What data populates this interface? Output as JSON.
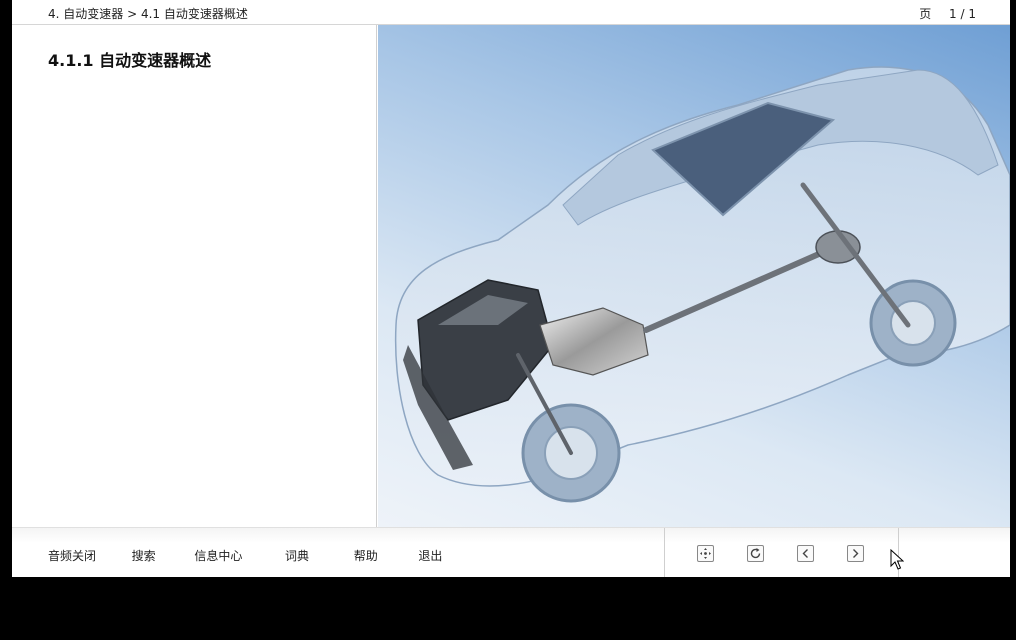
{
  "header": {
    "breadcrumb": "4. 自动变速器 > 4.1 自动变速器概述",
    "page_label": "页",
    "page_value": "1 / 1"
  },
  "content": {
    "section_title": "4.1.1 自动变速器概述"
  },
  "footer": {
    "links": [
      "音频关闭",
      "搜索",
      "信息中心",
      "词典",
      "帮助",
      "退出"
    ]
  },
  "icons": {
    "center_view": "center-view-icon",
    "reload": "reload-icon",
    "previous": "chevron-left-icon",
    "next": "chevron-right-icon"
  },
  "colors": {
    "image_background_top": "#6f9fd4",
    "image_background_bottom": "#eef3f9"
  }
}
